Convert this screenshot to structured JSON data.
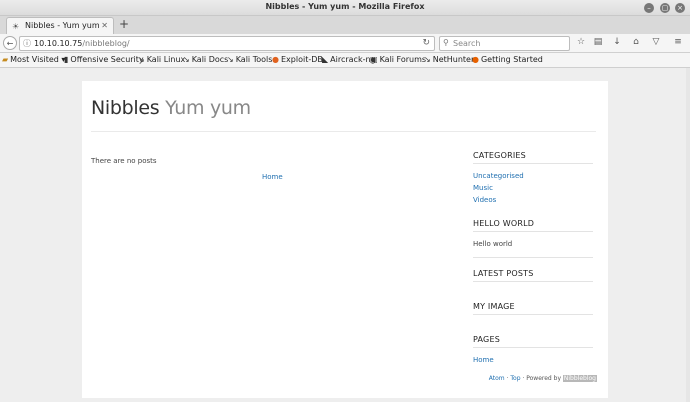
{
  "window": {
    "title": "Nibbles - Yum yum - Mozilla Firefox"
  },
  "tabs": [
    {
      "label": "Nibbles - Yum yum"
    }
  ],
  "nav": {
    "url_host": "10.10.10.75",
    "url_path": "/nibbleblog/",
    "search_placeholder": "Search"
  },
  "bookmarks": [
    {
      "label": "Most Visited",
      "icon": "folder-icon"
    },
    {
      "label": "Offensive Security",
      "icon": "offsec-icon"
    },
    {
      "label": "Kali Linux",
      "icon": "kali-icon"
    },
    {
      "label": "Kali Docs",
      "icon": "kali-icon"
    },
    {
      "label": "Kali Tools",
      "icon": "kali-icon"
    },
    {
      "label": "Exploit-DB",
      "icon": "exploitdb-icon"
    },
    {
      "label": "Aircrack-ng",
      "icon": "aircrack-icon"
    },
    {
      "label": "Kali Forums",
      "icon": "kali-forums-icon"
    },
    {
      "label": "NetHunter",
      "icon": "kali-icon"
    },
    {
      "label": "Getting Started",
      "icon": "firefox-icon"
    }
  ],
  "blog": {
    "name": "Nibbles",
    "slogan": "Yum yum",
    "no_posts": "There are no posts",
    "home_link": "Home"
  },
  "sidebar": {
    "categories_title": "CATEGORIES",
    "categories": [
      "Uncategorised",
      "Music",
      "Videos"
    ],
    "hello_title": "HELLO WORLD",
    "hello_text": "Hello world",
    "latest_title": "LATEST POSTS",
    "image_title": "MY IMAGE",
    "pages_title": "PAGES",
    "pages": [
      "Home"
    ]
  },
  "footer": {
    "atom": "Atom",
    "sep": " · ",
    "top": "Top",
    "powered": " · Powered by ",
    "brand": "Nibbleblog"
  }
}
